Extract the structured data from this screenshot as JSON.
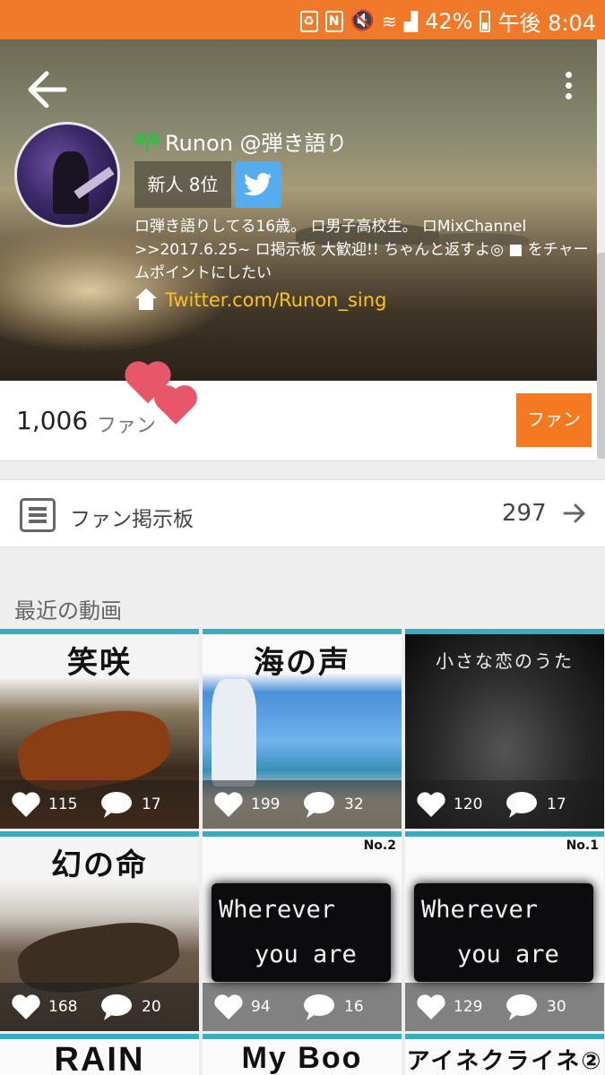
{
  "status_bar": {
    "battery": "42%",
    "time": "午後 8:04"
  },
  "profile": {
    "name": "Runon @弾き語り",
    "rank": "新人 8位",
    "bio": "ロ弾き語りしてる16歳。 ロ男子高校生。 ロMixChannel >>2017.6.25~ ロ掲示板 大歓迎!! ちゃんと返すよ◎ ■ をチャームポイントにしたい",
    "link": "Twitter.com/Runon_sing"
  },
  "fans": {
    "count": "1,006",
    "label": "ファン",
    "button": "ファン"
  },
  "board": {
    "label": "ファン掲示板",
    "count": "297"
  },
  "recent": {
    "title": "最近の動画",
    "videos": [
      {
        "caption": "笑咲",
        "likes": "115",
        "comments": "17"
      },
      {
        "caption": "海の声",
        "likes": "199",
        "comments": "32"
      },
      {
        "caption": "小さな恋のうた",
        "likes": "120",
        "comments": "17"
      },
      {
        "caption": "幻の命",
        "likes": "168",
        "comments": "20"
      },
      {
        "caption": "Wherever you are",
        "tag": "No.2",
        "likes": "94",
        "comments": "16"
      },
      {
        "caption": "Wherever you are",
        "tag": "No.1",
        "likes": "129",
        "comments": "30"
      },
      {
        "caption": "RAIN"
      },
      {
        "caption": "My Boo"
      },
      {
        "caption": "アイネクライネ②"
      }
    ]
  },
  "colors": {
    "status_bar": "#f07a2a",
    "accent": "#f47920",
    "twitter": "#55acee",
    "link": "#ffc21c",
    "card_border": "#3aacc0"
  }
}
